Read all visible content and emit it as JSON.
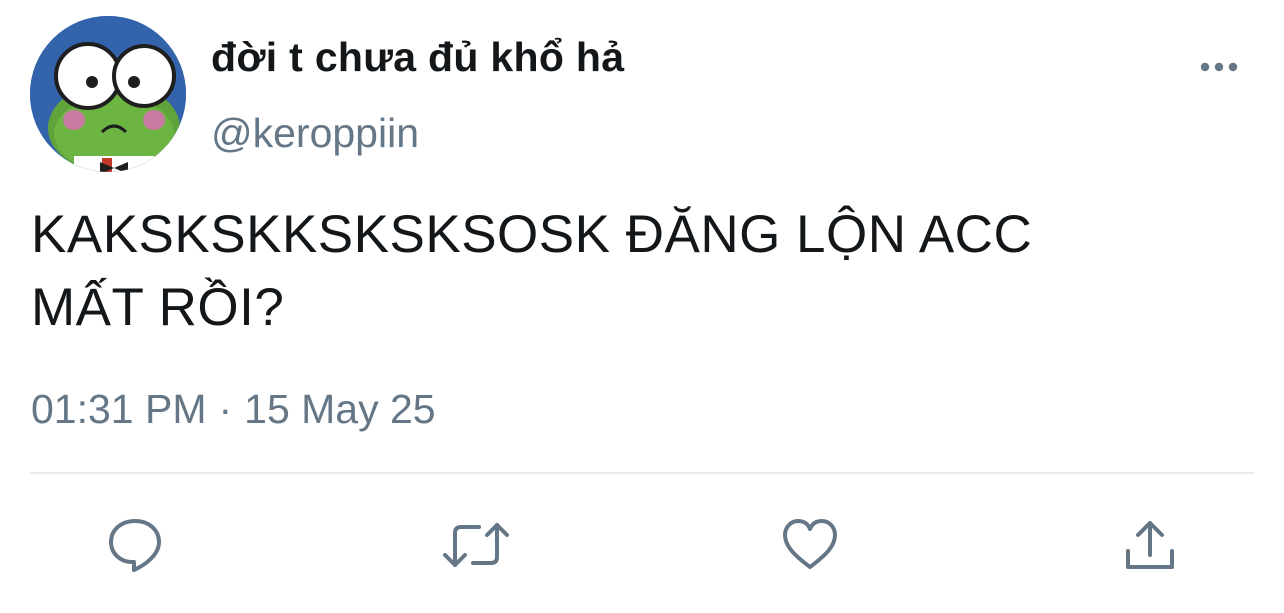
{
  "tweet": {
    "display_name": "đời t chưa đủ khổ hả",
    "handle": "@keroppiin",
    "text_line1": "KAKSKSKKSKSKSOSK ĐĂNG LỘN ACC",
    "text_line2": "MẤT RỒI?",
    "time": "01:31 PM",
    "separator": "·",
    "date": "15 May 25"
  },
  "icons": {
    "more": "more-horizontal-icon",
    "reply": "reply-bubble-icon",
    "retweet": "retweet-icon",
    "like": "heart-icon",
    "share": "share-upload-icon"
  },
  "colors": {
    "text": "#14171a",
    "secondary": "#657786",
    "icon": "#657786",
    "divider": "#e6ecf0",
    "avatar_bg": "#2f5fa6"
  }
}
